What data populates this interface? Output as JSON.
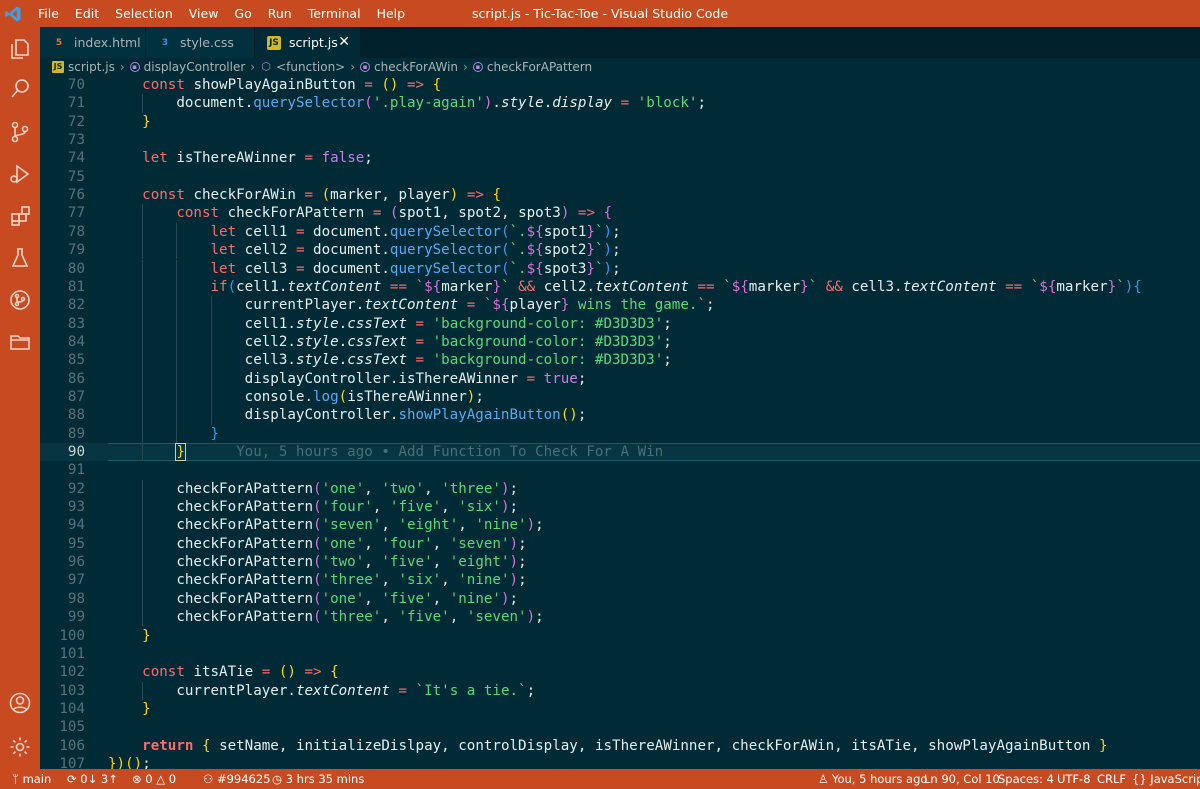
{
  "window": {
    "title": "script.js - Tic-Tac-Toe - Visual Studio Code"
  },
  "menu": [
    "File",
    "Edit",
    "Selection",
    "View",
    "Go",
    "Run",
    "Terminal",
    "Help"
  ],
  "activity_icons": [
    "explorer-icon",
    "search-icon",
    "source-control-icon",
    "run-debug-icon",
    "extensions-icon",
    "testing-icon",
    "git-graph-icon",
    "remote-explorer-icon",
    "accounts-icon",
    "manage-gear-icon"
  ],
  "tabs": [
    {
      "label": "index.html",
      "icon": "html-file-icon",
      "active": false
    },
    {
      "label": "style.css",
      "icon": "css-file-icon",
      "active": false
    },
    {
      "label": "script.js",
      "icon": "js-file-icon",
      "active": true
    }
  ],
  "breadcrumb": [
    "script.js",
    "displayController",
    "<function>",
    "checkForAWin",
    "checkForAPattern"
  ],
  "editor": {
    "current_line": 90,
    "blame": "You, 5 hours ago • Add Function To Check For A Win",
    "lines": [
      {
        "n": 70,
        "t": "    const showPlayAgainButton = () => {"
      },
      {
        "n": 71,
        "t": "        document.querySelector('.play-again').style.display = 'block';"
      },
      {
        "n": 72,
        "t": "    }"
      },
      {
        "n": 73,
        "t": ""
      },
      {
        "n": 74,
        "t": "    let isThereAWinner = false;"
      },
      {
        "n": 75,
        "t": ""
      },
      {
        "n": 76,
        "t": "    const checkForAWin = (marker, player) => {"
      },
      {
        "n": 77,
        "t": "        const checkForAPattern = (spot1, spot2, spot3) => {"
      },
      {
        "n": 78,
        "t": "            let cell1 = document.querySelector(`.${spot1}`);"
      },
      {
        "n": 79,
        "t": "            let cell2 = document.querySelector(`.${spot2}`);"
      },
      {
        "n": 80,
        "t": "            let cell3 = document.querySelector(`.${spot3}`);"
      },
      {
        "n": 81,
        "t": "            if(cell1.textContent == `${marker}` && cell2.textContent == `${marker}` && cell3.textContent == `${marker}`){"
      },
      {
        "n": 82,
        "t": "                currentPlayer.textContent = `${player} wins the game.`;"
      },
      {
        "n": 83,
        "t": "                cell1.style.cssText = 'background-color: #D3D3D3';"
      },
      {
        "n": 84,
        "t": "                cell2.style.cssText = 'background-color: #D3D3D3';"
      },
      {
        "n": 85,
        "t": "                cell3.style.cssText = 'background-color: #D3D3D3';"
      },
      {
        "n": 86,
        "t": "                displayController.isThereAWinner = true;"
      },
      {
        "n": 87,
        "t": "                console.log(isThereAWinner);"
      },
      {
        "n": 88,
        "t": "                displayController.showPlayAgainButton();"
      },
      {
        "n": 89,
        "t": "            }"
      },
      {
        "n": 90,
        "t": "        }"
      },
      {
        "n": 91,
        "t": ""
      },
      {
        "n": 92,
        "t": "        checkForAPattern('one', 'two', 'three');"
      },
      {
        "n": 93,
        "t": "        checkForAPattern('four', 'five', 'six');"
      },
      {
        "n": 94,
        "t": "        checkForAPattern('seven', 'eight', 'nine');"
      },
      {
        "n": 95,
        "t": "        checkForAPattern('one', 'four', 'seven');"
      },
      {
        "n": 96,
        "t": "        checkForAPattern('two', 'five', 'eight');"
      },
      {
        "n": 97,
        "t": "        checkForAPattern('three', 'six', 'nine');"
      },
      {
        "n": 98,
        "t": "        checkForAPattern('one', 'five', 'nine');"
      },
      {
        "n": 99,
        "t": "        checkForAPattern('three', 'five', 'seven');"
      },
      {
        "n": 100,
        "t": "    }"
      },
      {
        "n": 101,
        "t": ""
      },
      {
        "n": 102,
        "t": "    const itsATie = () => {"
      },
      {
        "n": 103,
        "t": "        currentPlayer.textContent = `It's a tie.`;"
      },
      {
        "n": 104,
        "t": "    }"
      },
      {
        "n": 105,
        "t": ""
      },
      {
        "n": 106,
        "t": "    return { setName, initializeDislpay, controlDisplay, isThereAWinner, checkForAWin, itsATie, showPlayAgainButton }"
      },
      {
        "n": 107,
        "t": "})();"
      }
    ]
  },
  "statusbar": {
    "branch": "main",
    "sync": "0↓ 3↑",
    "errors": "0",
    "warnings": "0",
    "issue": "#994625",
    "time": "3 hrs 35 mins",
    "blame": "You, 5 hours ago",
    "position": "Ln 90, Col 10",
    "spaces": "Spaces: 4",
    "encoding": "UTF-8",
    "eol": "CRLF",
    "language": "JavaScript"
  },
  "colors": {
    "accent": "#c74a21",
    "editor_bg": "#002b36",
    "keyword": "#ff6a6a",
    "string": "#59d97a",
    "method": "#5aa9f0"
  }
}
